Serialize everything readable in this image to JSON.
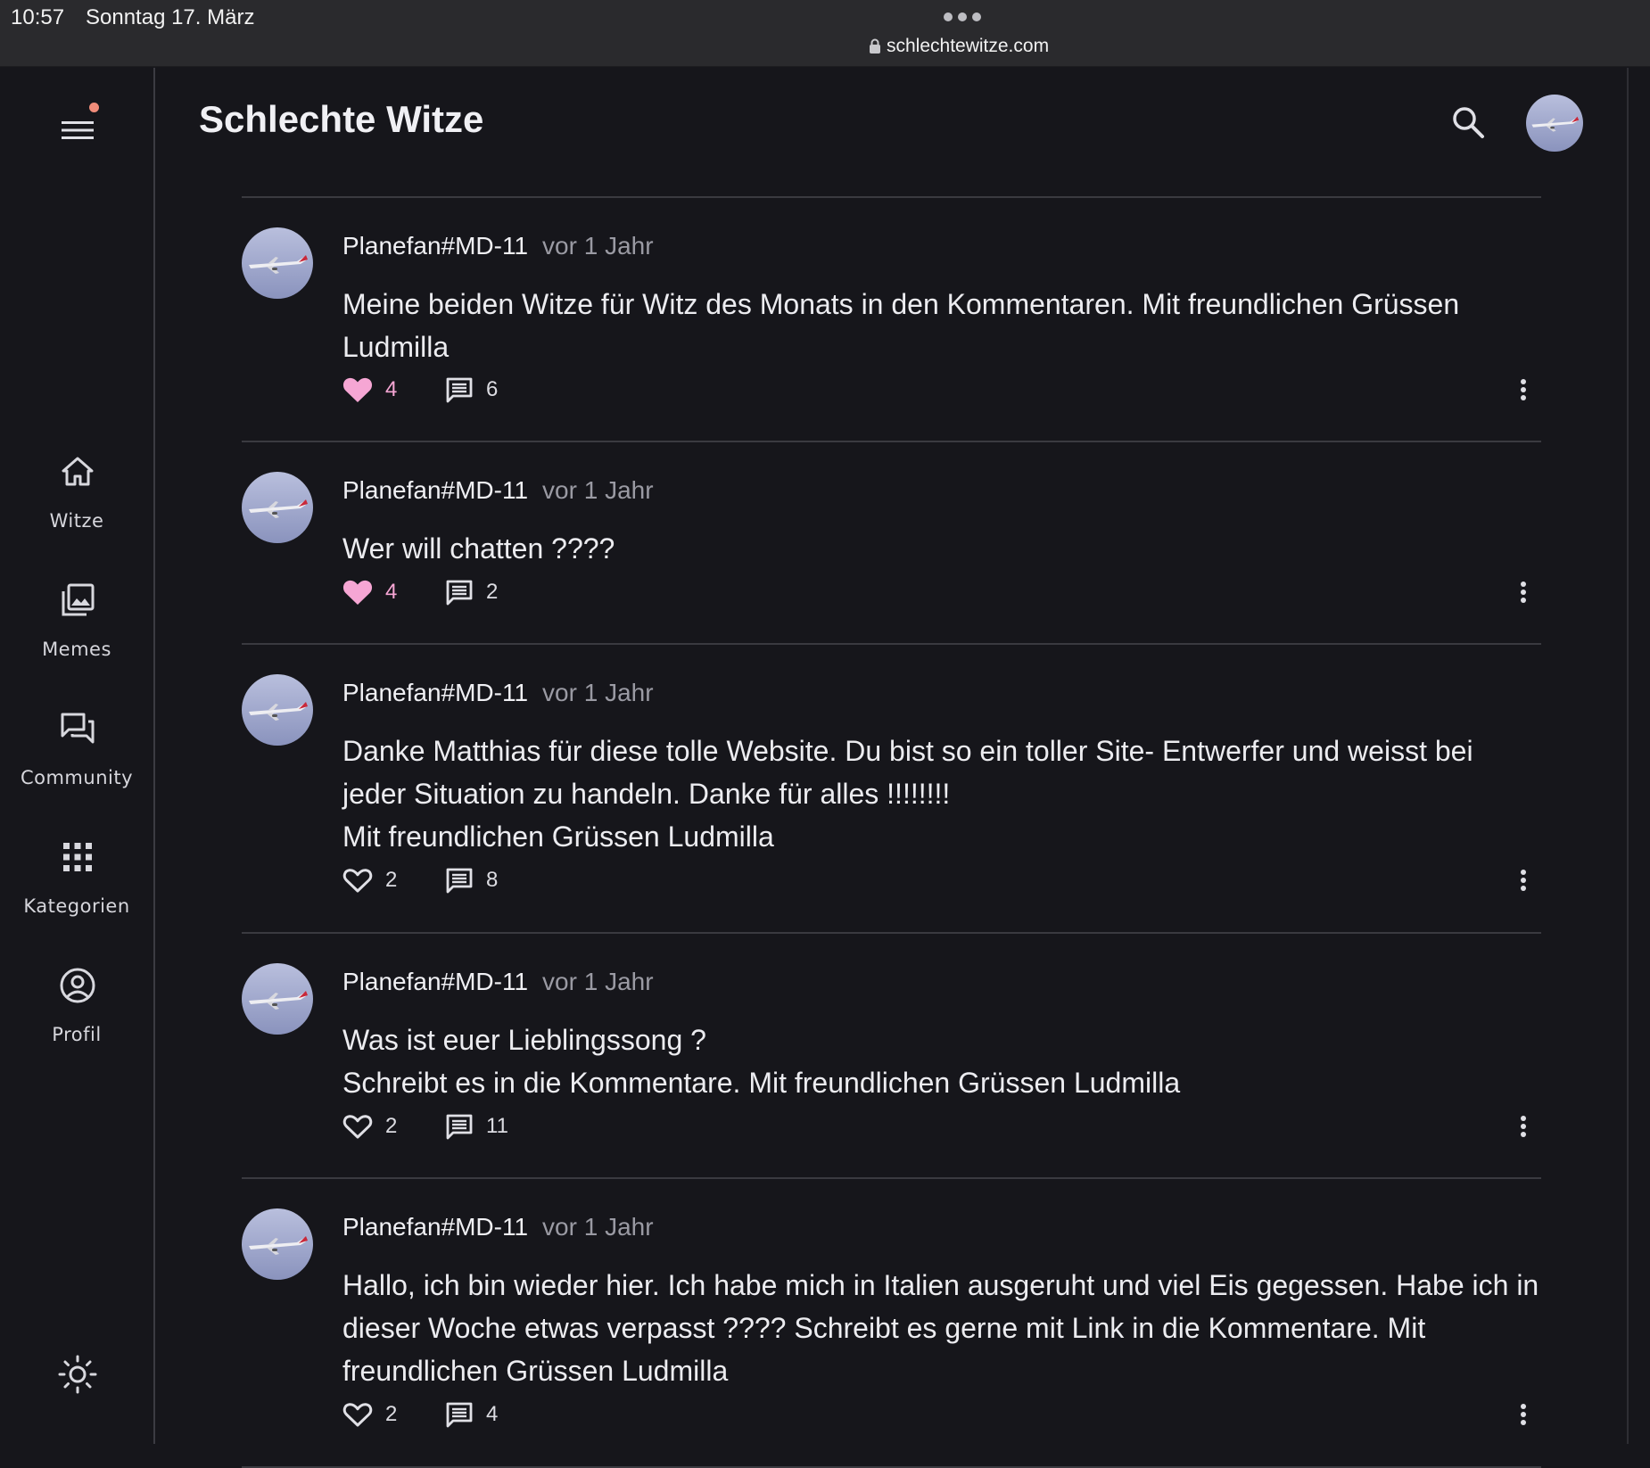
{
  "status": {
    "time": "10:57",
    "date": "Sonntag 17. März",
    "url": "schlechtewitze.com"
  },
  "app": {
    "title": "Schlechte Witze"
  },
  "nav": {
    "items": [
      {
        "label": "Witze",
        "icon": "home-icon"
      },
      {
        "label": "Memes",
        "icon": "photo-library-icon"
      },
      {
        "label": "Community",
        "icon": "forum-icon"
      },
      {
        "label": "Kategorien",
        "icon": "apps-grid-icon"
      },
      {
        "label": "Profil",
        "icon": "account-circle-icon"
      }
    ]
  },
  "colors": {
    "background": "#16161b",
    "accent_pink": "#f6a6d4",
    "notification_dot": "#f08c7a"
  },
  "posts": [
    {
      "author": "Planefan#MD-11",
      "time": "vor 1 Jahr",
      "lines": [
        "Meine beiden Witze für Witz des Monats in den Kommentaren. Mit freundlichen Grüssen Ludmilla"
      ],
      "likes": "4",
      "liked": true,
      "comments": "6"
    },
    {
      "author": "Planefan#MD-11",
      "time": "vor 1 Jahr",
      "lines": [
        "Wer will chatten ????"
      ],
      "likes": "4",
      "liked": true,
      "comments": "2"
    },
    {
      "author": "Planefan#MD-11",
      "time": "vor 1 Jahr",
      "lines": [
        "Danke Matthias für diese tolle Website. Du bist so ein toller Site- Entwerfer und weisst bei jeder Situation zu handeln. Danke für alles !!!!!!!!",
        "Mit freundlichen Grüssen Ludmilla"
      ],
      "likes": "2",
      "liked": false,
      "comments": "8"
    },
    {
      "author": "Planefan#MD-11",
      "time": "vor 1 Jahr",
      "lines": [
        "Was ist euer Lieblingssong ?",
        "Schreibt es in die Kommentare. Mit freundlichen Grüssen Ludmilla"
      ],
      "likes": "2",
      "liked": false,
      "comments": "11"
    },
    {
      "author": "Planefan#MD-11",
      "time": "vor 1 Jahr",
      "lines": [
        "Hallo, ich bin wieder hier. Ich habe mich in Italien ausgeruht und viel Eis gegessen. Habe ich in dieser Woche etwas verpasst ???? Schreibt es gerne mit Link in die Kommentare. Mit freundlichen Grüssen Ludmilla"
      ],
      "likes": "2",
      "liked": false,
      "comments": "4"
    }
  ]
}
